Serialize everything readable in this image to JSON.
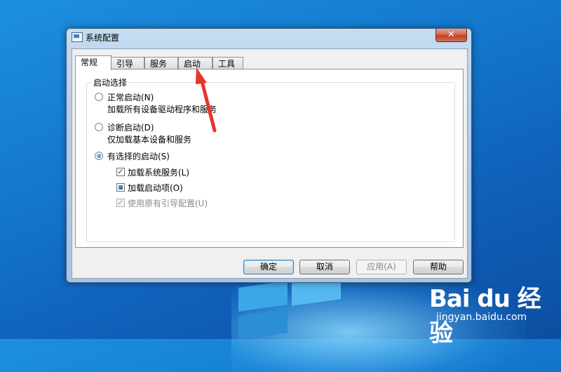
{
  "window": {
    "title": "系统配置",
    "close_glyph": "✕"
  },
  "tabs": [
    {
      "label": "常规",
      "active": true
    },
    {
      "label": "引导",
      "active": false
    },
    {
      "label": "服务",
      "active": false
    },
    {
      "label": "启动",
      "active": false
    },
    {
      "label": "工具",
      "active": false
    }
  ],
  "startup_selection": {
    "group_label": "启动选择",
    "options": [
      {
        "label": "正常启动(N)",
        "description": "加载所有设备驱动程序和服务",
        "selected": false
      },
      {
        "label": "诊断启动(D)",
        "description": "仅加载基本设备和服务",
        "selected": false
      },
      {
        "label": "有选择的启动(S)",
        "description": "",
        "selected": true
      }
    ],
    "checkboxes": [
      {
        "label": "加载系统服务(L)",
        "state": "checked",
        "enabled": true
      },
      {
        "label": "加载启动项(O)",
        "state": "indeterminate",
        "enabled": true
      },
      {
        "label": "使用原有引导配置(U)",
        "state": "checked",
        "enabled": false
      }
    ]
  },
  "buttons": {
    "ok": "确定",
    "cancel": "取消",
    "apply": "应用(A)",
    "help": "帮助"
  },
  "watermark": {
    "logo": "Bai du 经验",
    "url": "jingyan.baidu.com"
  },
  "colors": {
    "desktop": "#1479cf",
    "window_frame": "#b7cfe8",
    "close_button": "#c9442d",
    "annotation_arrow": "#e8352c"
  }
}
